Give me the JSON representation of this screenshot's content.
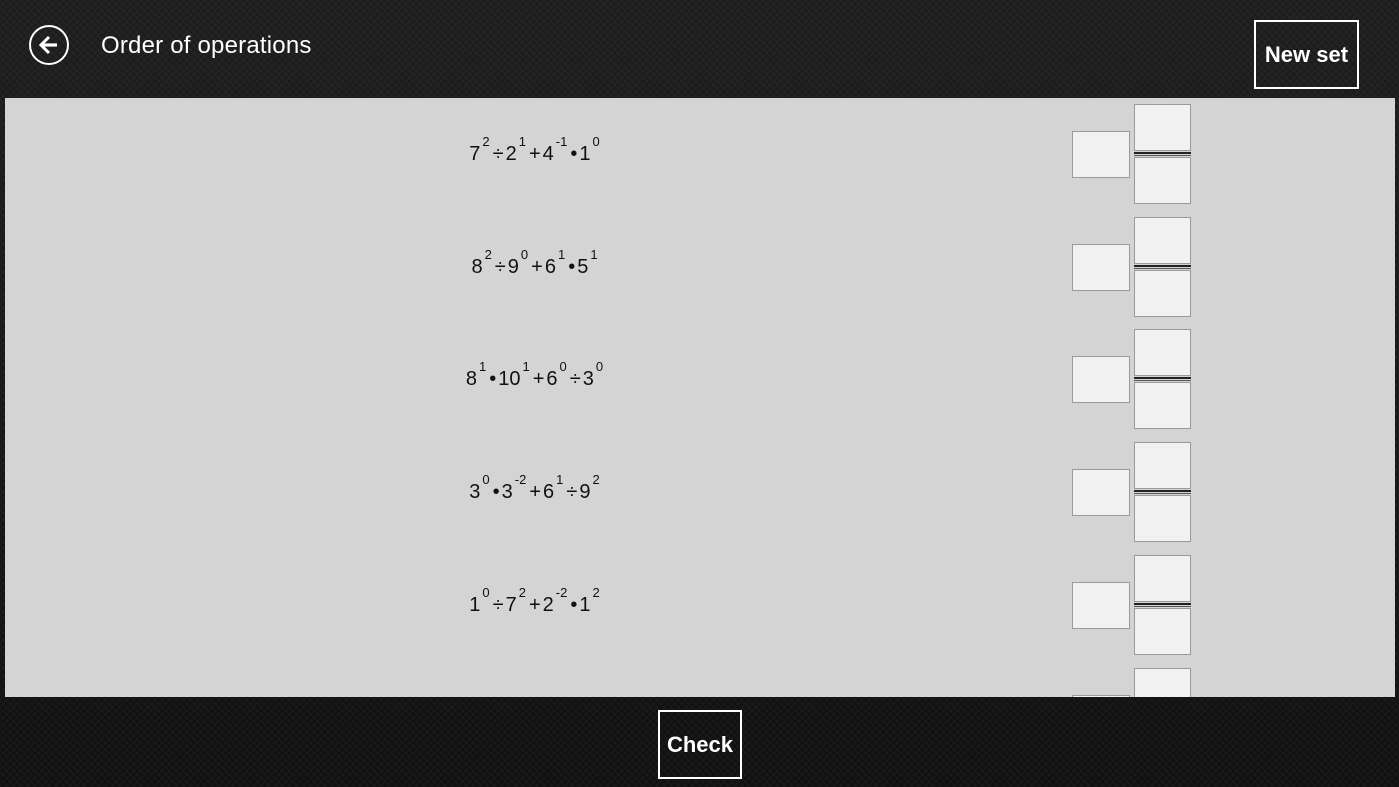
{
  "header": {
    "title": "Order of operations",
    "back_icon": "arrow-left-icon",
    "new_set_label": "New set"
  },
  "problems": [
    {
      "terms": [
        {
          "base": "7",
          "exp": "2"
        },
        {
          "op": "÷"
        },
        {
          "base": "2",
          "exp": "1"
        },
        {
          "op": "+"
        },
        {
          "base": "4",
          "exp": "-1"
        },
        {
          "op": "•"
        },
        {
          "base": "1",
          "exp": "0"
        }
      ]
    },
    {
      "terms": [
        {
          "base": "8",
          "exp": "2"
        },
        {
          "op": "÷"
        },
        {
          "base": "9",
          "exp": "0"
        },
        {
          "op": "+"
        },
        {
          "base": "6",
          "exp": "1"
        },
        {
          "op": "•"
        },
        {
          "base": "5",
          "exp": "1"
        }
      ]
    },
    {
      "terms": [
        {
          "base": "8",
          "exp": "1"
        },
        {
          "op": "•"
        },
        {
          "base": "10",
          "exp": "1"
        },
        {
          "op": "+"
        },
        {
          "base": "6",
          "exp": "0"
        },
        {
          "op": "÷"
        },
        {
          "base": "3",
          "exp": "0"
        }
      ]
    },
    {
      "terms": [
        {
          "base": "3",
          "exp": "0"
        },
        {
          "op": "•"
        },
        {
          "base": "3",
          "exp": "-2"
        },
        {
          "op": "+"
        },
        {
          "base": "6",
          "exp": "1"
        },
        {
          "op": "÷"
        },
        {
          "base": "9",
          "exp": "2"
        }
      ]
    },
    {
      "terms": [
        {
          "base": "1",
          "exp": "0"
        },
        {
          "op": "÷"
        },
        {
          "base": "7",
          "exp": "2"
        },
        {
          "op": "+"
        },
        {
          "base": "2",
          "exp": "-2"
        },
        {
          "op": "•"
        },
        {
          "base": "1",
          "exp": "2"
        }
      ]
    }
  ],
  "footer": {
    "check_label": "Check"
  }
}
